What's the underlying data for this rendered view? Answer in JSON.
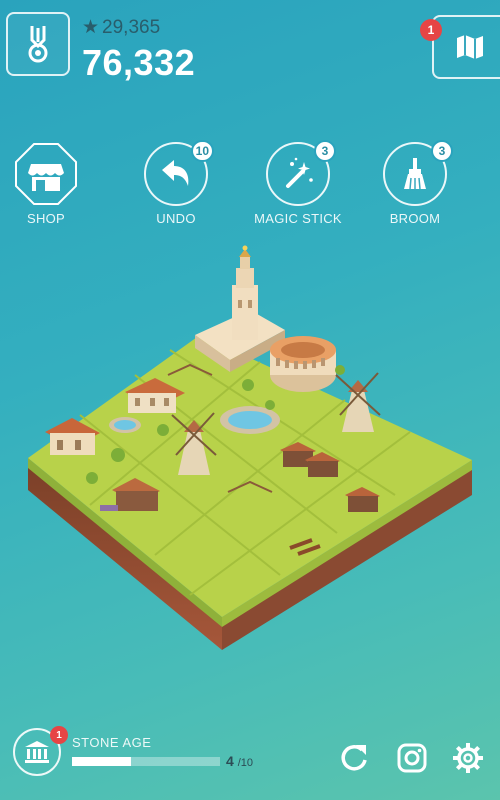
{
  "header": {
    "star_score": "29,365",
    "main_score": "76,332",
    "map_badge": "1"
  },
  "icons": {
    "medal": "medal-icon",
    "star": "star-icon",
    "map": "map-icon",
    "shop": "shop-icon",
    "undo": "undo-arrow-icon",
    "magic_stick": "magic-wand-icon",
    "broom": "broom-icon",
    "era": "museum-icon",
    "restart": "restart-icon",
    "instagram": "instagram-icon",
    "settings": "gear-icon"
  },
  "tools": [
    {
      "label": "SHOP",
      "count": ""
    },
    {
      "label": "UNDO",
      "count": "10"
    },
    {
      "label": "MAGIC STICK",
      "count": "3"
    },
    {
      "label": "BROOM",
      "count": "3"
    }
  ],
  "footer": {
    "era_badge": "1",
    "era_name": "STONE AGE",
    "progress_current": "4",
    "progress_total": "/10",
    "progress_fraction": 0.4
  },
  "colors": {
    "background_top": "#2aa3bd",
    "background_bottom": "#5bc4ad",
    "badge_red": "#e64545",
    "grass": "#b8d24a",
    "soil": "#8a4a32"
  }
}
